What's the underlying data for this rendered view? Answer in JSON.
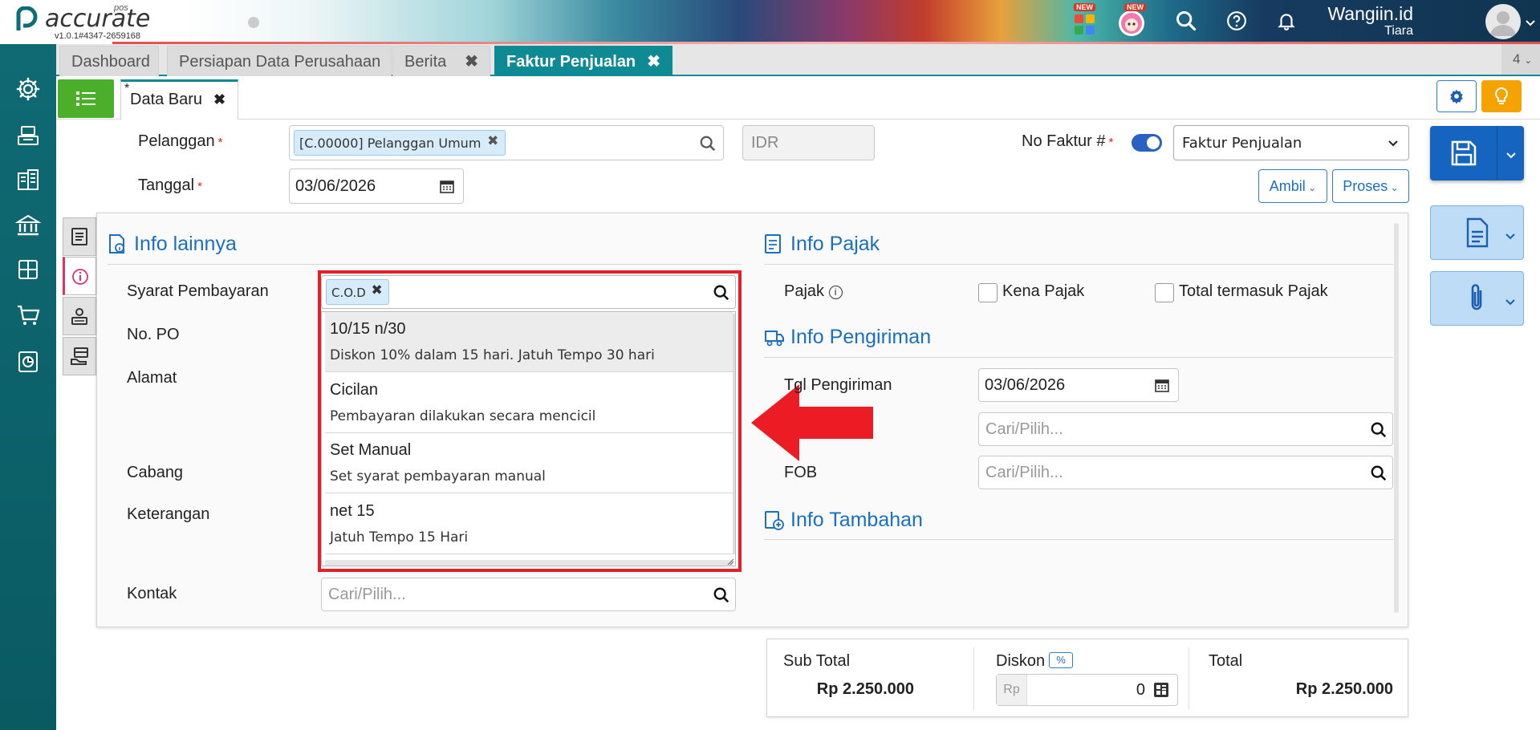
{
  "header": {
    "logo_text": "accurate",
    "logo_sub": "pos",
    "version": "v1.0.1#4347-2659168",
    "badge_new_1": "NEW",
    "badge_new_2": "NEW",
    "user_company": "Wangiin.id",
    "user_name": "Tiara"
  },
  "tabs": [
    {
      "label": "Dashboard"
    },
    {
      "label": "Persiapan Data Perusahaan"
    },
    {
      "label": "Berita"
    },
    {
      "label": "Faktur Penjualan"
    }
  ],
  "tab_count": "4",
  "subtab": {
    "label": "Data Baru",
    "marker": "*"
  },
  "form": {
    "pelanggan_label": "Pelanggan",
    "pelanggan_chip": "[C.00000] Pelanggan Umum",
    "currency": "IDR",
    "no_faktur_label": "No Faktur #",
    "no_faktur_select": "Faktur Penjualan",
    "tanggal_label": "Tanggal",
    "tanggal_value": "03/06/2026",
    "ambil_label": "Ambil",
    "proses_label": "Proses",
    "required_mark": "*"
  },
  "info_lainnya": {
    "title": "Info lainnya",
    "syarat_label": "Syarat Pembayaran",
    "syarat_chip": "C.O.D",
    "no_po_label": "No. PO",
    "alamat_label": "Alamat",
    "cabang_label": "Cabang",
    "keterangan_label": "Keterangan",
    "kontak_label": "Kontak",
    "kontak_placeholder": "Cari/Pilih..."
  },
  "dropdown": {
    "items": [
      {
        "title": "10/15 n/30",
        "desc": "Diskon 10% dalam 15 hari. Jatuh Tempo 30 hari"
      },
      {
        "title": "Cicilan",
        "desc": "Pembayaran dilakukan secara mencicil"
      },
      {
        "title": "Set Manual",
        "desc": "Set syarat pembayaran manual"
      },
      {
        "title": "net 15",
        "desc": "Jatuh Tempo 15 Hari"
      }
    ]
  },
  "info_pajak": {
    "title": "Info Pajak",
    "pajak_label": "Pajak",
    "kena_pajak": "Kena Pajak",
    "total_termasuk": "Total termasuk Pajak"
  },
  "info_pengiriman": {
    "title": "Info Pengiriman",
    "tgl_label": "Tgl Pengiriman",
    "tgl_value": "03/06/2026",
    "pengiriman_placeholder": "Cari/Pilih...",
    "fob_label": "FOB",
    "fob_placeholder": "Cari/Pilih..."
  },
  "info_tambahan": {
    "title": "Info Tambahan"
  },
  "totals": {
    "subtotal_label": "Sub Total",
    "subtotal_value": "Rp 2.250.000",
    "diskon_label": "Diskon",
    "diskon_pct": "%",
    "diskon_prefix": "Rp",
    "diskon_value": "0",
    "total_label": "Total",
    "total_value": "Rp 2.250.000"
  },
  "colors": {
    "teal": "#0e8a95",
    "sidebar": "#0a5a62",
    "green": "#4caf2a",
    "blue": "#1a6fc0",
    "save_blue": "#1565c0",
    "highlight_red": "#e0202a",
    "orange": "#f5a300"
  }
}
